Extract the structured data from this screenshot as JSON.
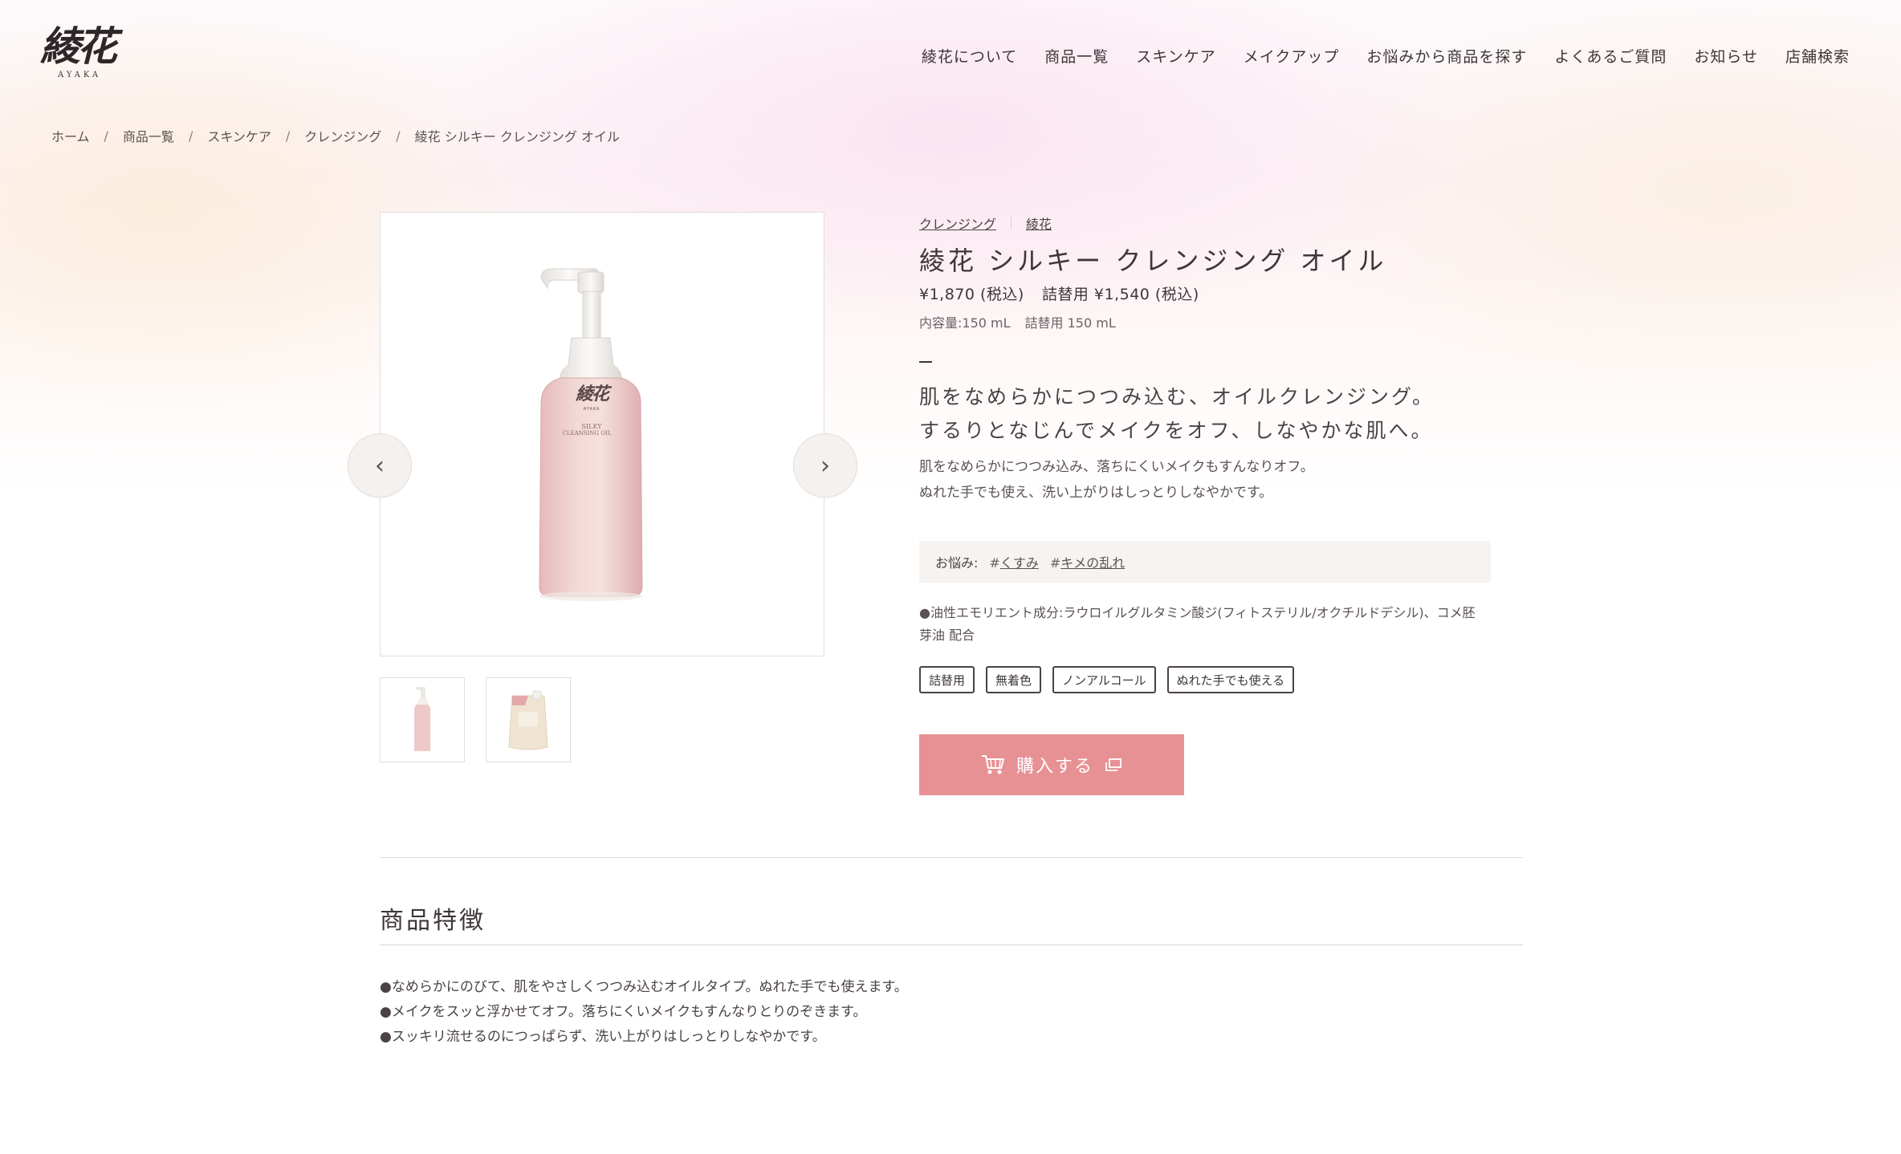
{
  "brand": {
    "logo_text": "綾花",
    "logo_sub": "AYAKA"
  },
  "nav": {
    "items": [
      {
        "label": "綾花について"
      },
      {
        "label": "商品一覧"
      },
      {
        "label": "スキンケア"
      },
      {
        "label": "メイクアップ"
      },
      {
        "label": "お悩みから商品を探す"
      },
      {
        "label": "よくあるご質問"
      },
      {
        "label": "お知らせ"
      },
      {
        "label": "店舗検索"
      }
    ]
  },
  "breadcrumb": {
    "separator": "/",
    "items": [
      {
        "label": "ホーム"
      },
      {
        "label": "商品一覧"
      },
      {
        "label": "スキンケア"
      },
      {
        "label": "クレンジング"
      },
      {
        "label": "綾花 シルキー クレンジング オイル"
      }
    ]
  },
  "gallery": {
    "prev_icon": "‹",
    "next_icon": "›",
    "bottle_logo": "綾花",
    "bottle_brand": "AYAKA",
    "bottle_label_1": "SILKY",
    "bottle_label_2": "CLEANSING OIL"
  },
  "product": {
    "categories": [
      {
        "label": "クレンジング"
      },
      {
        "label": "綾花"
      }
    ],
    "title": "綾花 シルキー クレンジング オイル",
    "price": "¥1,870 (税込)",
    "refill_price": "詰替用 ¥1,540 (税込)",
    "volume": "内容量:150 mL",
    "refill_volume": "詰替用 150 mL",
    "catch_1": "肌をなめらかにつつみ込む、オイルクレンジング。",
    "catch_2": "するりとなじんでメイクをオフ、しなやかな肌へ。",
    "desc_1": "肌をなめらかにつつみ込み、落ちにくいメイクもすんなりオフ。",
    "desc_2": "ぬれた手でも使え、洗い上がりはしっとりしなやかです。",
    "concern_label": "お悩み:",
    "concerns": [
      {
        "hash": "#",
        "label": "くすみ"
      },
      {
        "hash": "#",
        "label": "キメの乱れ"
      }
    ],
    "ingredients": "●油性エモリエント成分:ラウロイルグルタミン酸ジ(フィトステリル/オクチルドデシル)、コメ胚芽油 配合",
    "badges": [
      {
        "label": "詰替用"
      },
      {
        "label": "無着色"
      },
      {
        "label": "ノンアルコール"
      },
      {
        "label": "ぬれた手でも使える"
      }
    ],
    "buy_label": "購入する",
    "buy_color": "#e79194"
  },
  "features": {
    "title": "商品特徴",
    "items": [
      {
        "text": "●なめらかにのびて、肌をやさしくつつみ込むオイルタイプ。ぬれた手でも使えます。"
      },
      {
        "text": "●メイクをスッと浮かせてオフ。落ちにくいメイクもすんなりとりのぞきます。"
      },
      {
        "text": "●スッキリ流せるのにつっぱらず、洗い上がりはしっとりしなやかです。"
      }
    ]
  }
}
